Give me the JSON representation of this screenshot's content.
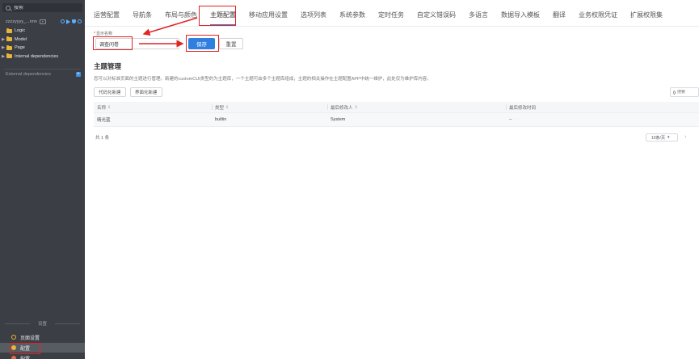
{
  "sidebar": {
    "search_placeholder": "搜索",
    "project_name": "zzzzyyyy_...nnn",
    "project_tag": "▾",
    "tree": [
      {
        "label": "Logic"
      },
      {
        "label": "Model"
      },
      {
        "label": "Page"
      },
      {
        "label": "Internal dependencies"
      }
    ],
    "external_label": "External dependencies",
    "section_label": "设置",
    "bottom_items": [
      {
        "label": "页面设置"
      },
      {
        "label": "配置"
      },
      {
        "label": "配置"
      }
    ]
  },
  "tabs": [
    {
      "label": "运营配置"
    },
    {
      "label": "导航条"
    },
    {
      "label": "布局与颜色"
    },
    {
      "label": "主题配置"
    },
    {
      "label": "移动应用设置"
    },
    {
      "label": "选项列表"
    },
    {
      "label": "系统参数"
    },
    {
      "label": "定时任务"
    },
    {
      "label": "自定义错误码"
    },
    {
      "label": "多语言"
    },
    {
      "label": "数据导入模板"
    },
    {
      "label": "翻译"
    },
    {
      "label": "业务权限凭证"
    },
    {
      "label": "扩展权限集"
    }
  ],
  "form": {
    "required_mark": "*",
    "field_label": "显示名称",
    "field_value": "调查问卷",
    "save_label": "保存",
    "reset_label": "重置"
  },
  "theme": {
    "title": "主题管理",
    "description": "您可以对标准页面的主题进行管理。新建的customCUI类型的为主题库，一个主题可由多个主题库组成，主题的相关操作在主题配置APP中统一维护，此处仅为维护库内容。",
    "buttons": [
      {
        "label": "代码化新建"
      },
      {
        "label": "界面化新建"
      }
    ],
    "search_placeholder": "搜索",
    "columns": [
      {
        "label": "名称"
      },
      {
        "label": "类型"
      },
      {
        "label": "最后修改人"
      },
      {
        "label": "最后修改时间"
      }
    ],
    "rows": [
      {
        "name": "晴光蓝",
        "type": "builtin",
        "modifier": "System",
        "time": "--"
      }
    ],
    "total": "共 1 条",
    "page_size": "10条/页",
    "next": "›"
  },
  "colors": {
    "accent": "#2f7fe0",
    "annotation": "#e02424",
    "sidebar_bg": "#3b3f45"
  }
}
